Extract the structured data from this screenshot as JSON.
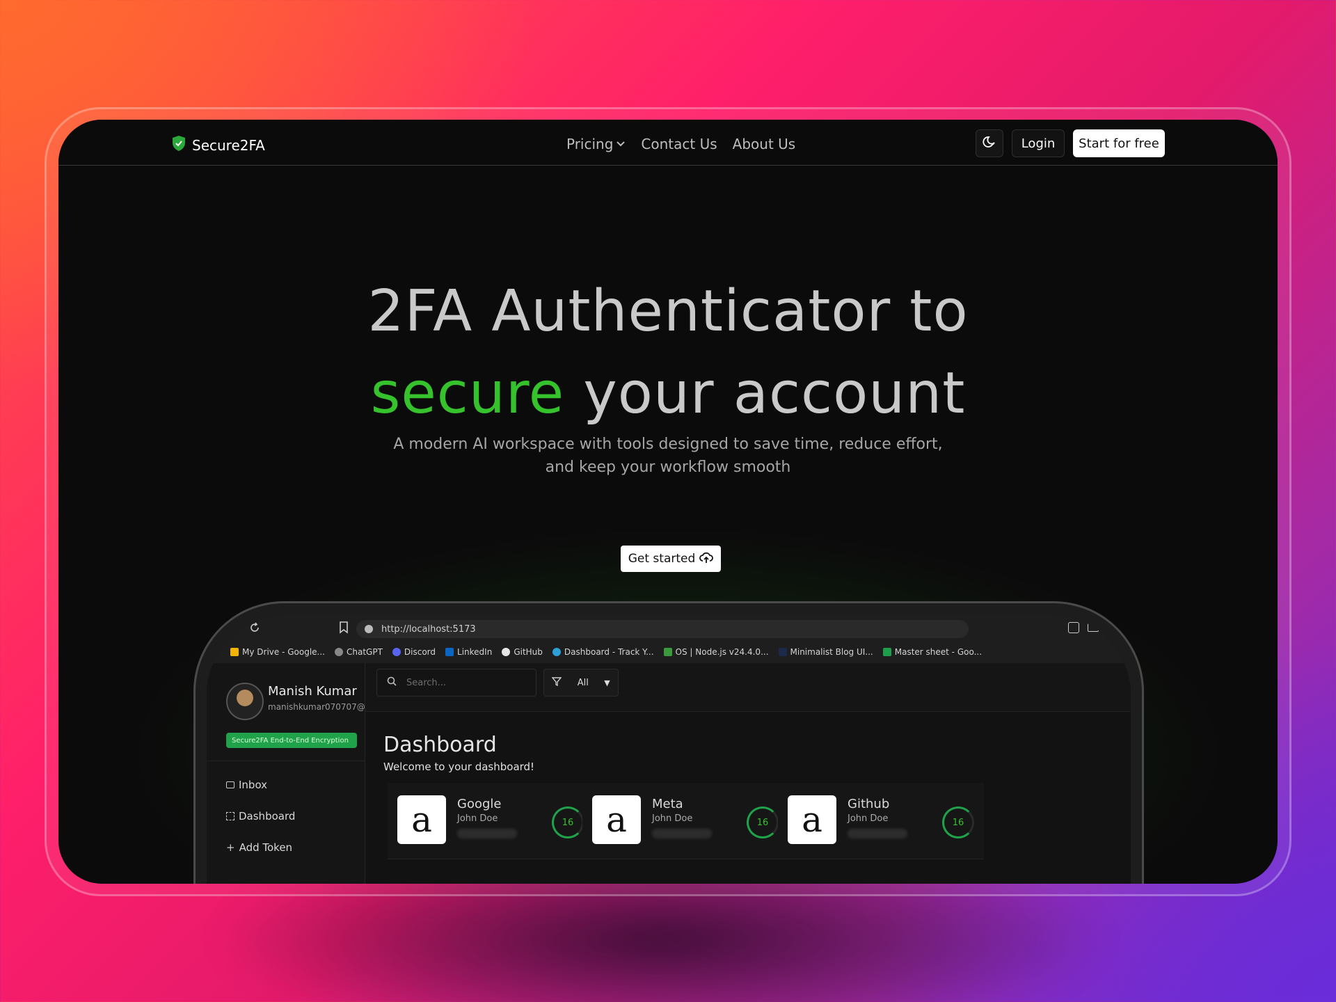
{
  "brand": {
    "name": "Secure2FA"
  },
  "nav": {
    "pricing": "Pricing",
    "contact": "Contact Us",
    "about": "About Us",
    "login": "Login",
    "start": "Start for free"
  },
  "hero": {
    "line1": "2FA Authenticator to",
    "accent": "secure",
    "line2_rest": " your account",
    "subtitle": "A modern AI workspace with tools designed to save time, reduce effort, and keep your workflow smooth",
    "cta": "Get started"
  },
  "browser": {
    "url": "http://localhost:5173",
    "bookmarks": [
      "My Drive - Google...",
      "ChatGPT",
      "Discord",
      "LinkedIn",
      "GitHub",
      "Dashboard - Track Y...",
      "OS | Node.js v24.4.0...",
      "Minimalist Blog UI...",
      "Master sheet - Goo..."
    ]
  },
  "app": {
    "user": {
      "name": "Manish Kumar",
      "email": "manishkumar070707@..."
    },
    "encryption_badge": "Secure2FA End-to-End Encryption",
    "sidebar": [
      {
        "label": "Inbox",
        "icon": "inbox-icon"
      },
      {
        "label": "Dashboard",
        "icon": "dashboard-icon"
      },
      {
        "label": "Add Token",
        "icon": "plus-icon"
      }
    ],
    "search_placeholder": "Search...",
    "filter": "All",
    "title": "Dashboard",
    "welcome": "Welcome to your dashboard!",
    "cards": [
      {
        "name": "Google",
        "user": "John Doe",
        "timer": "16"
      },
      {
        "name": "Meta",
        "user": "John Doe",
        "timer": "16"
      },
      {
        "name": "Github",
        "user": "John Doe",
        "timer": "16"
      }
    ]
  },
  "colors": {
    "accent": "#35c22c",
    "badge": "#1fa24a",
    "background": "#0b0b0b"
  }
}
